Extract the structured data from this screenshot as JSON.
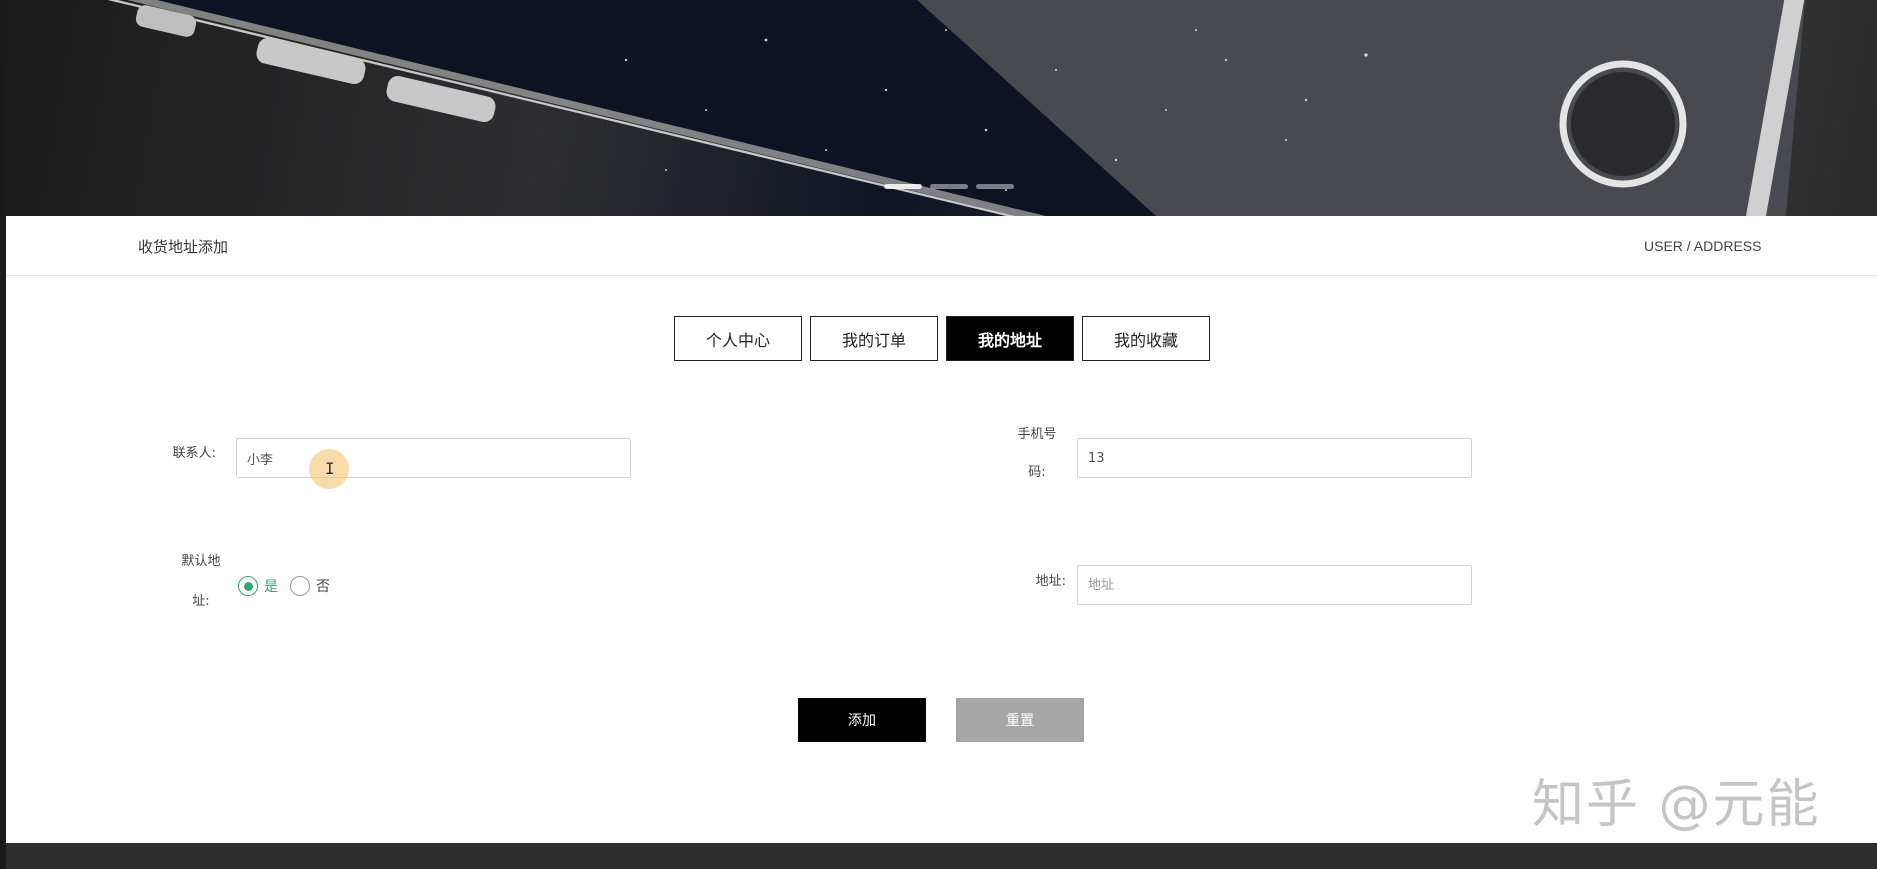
{
  "hero": {
    "carousel_dots": [
      "slide-1",
      "slide-2",
      "slide-3"
    ],
    "active_slide": 1
  },
  "header": {
    "page_title": "收货地址添加",
    "breadcrumb": "USER / ADDRESS"
  },
  "tabs": [
    {
      "label": "个人中心",
      "active": false
    },
    {
      "label": "我的订单",
      "active": false
    },
    {
      "label": "我的地址",
      "active": true
    },
    {
      "label": "我的收藏",
      "active": false
    }
  ],
  "form": {
    "contact": {
      "label": "联系人:",
      "value": "小李"
    },
    "phone": {
      "label_line1": "手机号",
      "label_line2": "码:",
      "value": "13"
    },
    "default_address": {
      "label_line1": "默认地",
      "label_line2": "址:",
      "options": [
        {
          "label": "是",
          "checked": true
        },
        {
          "label": "否",
          "checked": false
        }
      ]
    },
    "address": {
      "label": "地址:",
      "placeholder": "地址",
      "value": ""
    }
  },
  "buttons": {
    "add_label": "添加",
    "reset_label": "重置"
  },
  "watermark": "知乎 @元能",
  "colors": {
    "accent_green": "#3aa36e",
    "active_tab": "#000000",
    "reset_button": "#a6a6a6",
    "footer": "#2d2d2d"
  }
}
